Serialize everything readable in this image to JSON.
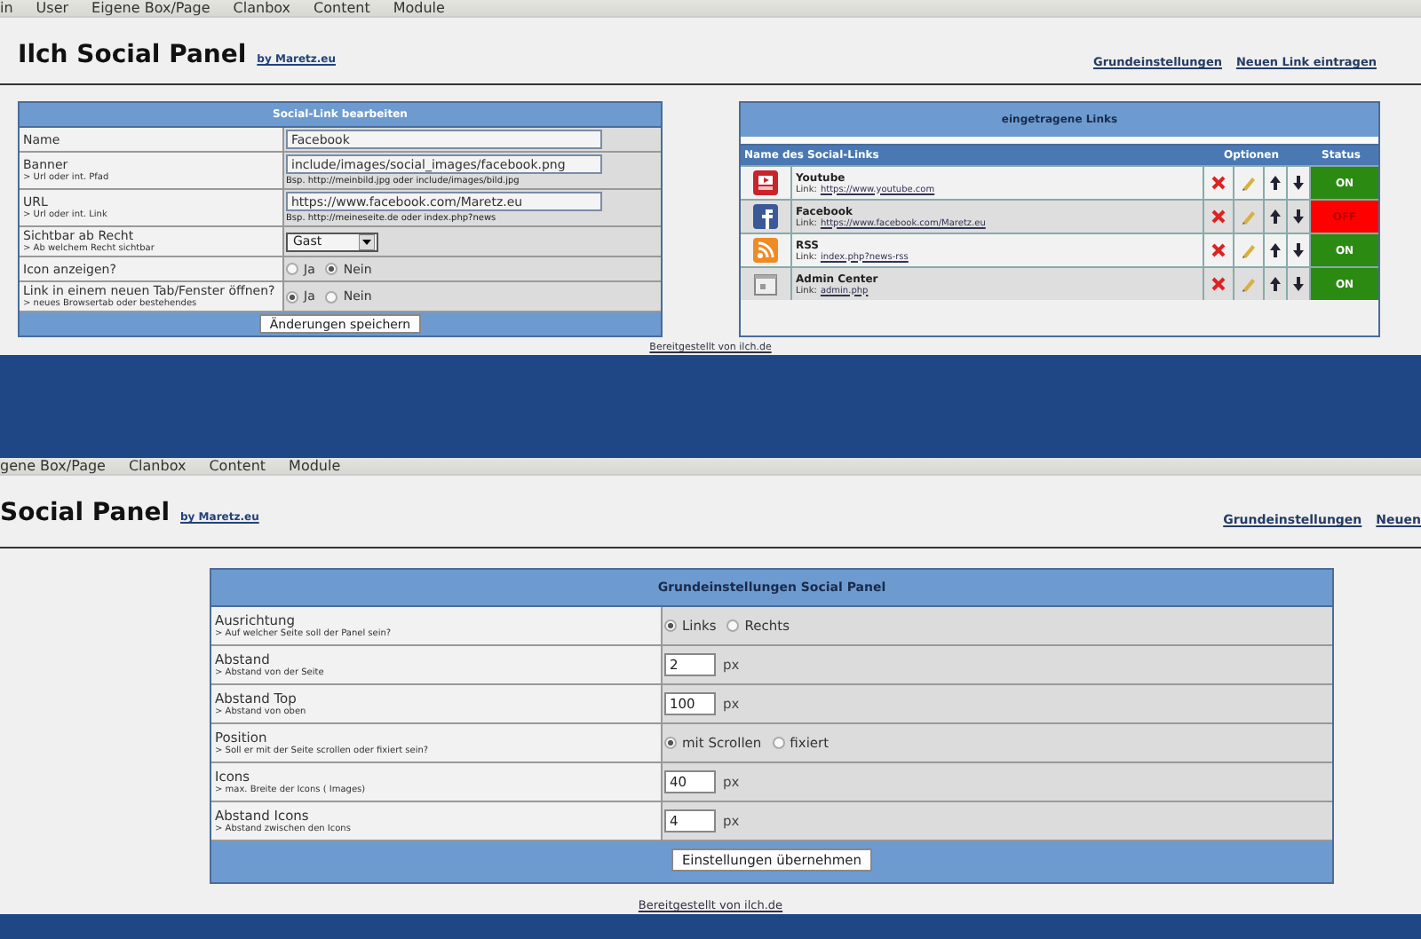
{
  "top_screen": {
    "menu": [
      "in",
      "User",
      "Eigene Box/Page",
      "Clanbox",
      "Content",
      "Module"
    ],
    "title": "Ilch Social Panel",
    "byline": "by Maretz.eu",
    "header_links": [
      "Grundeinstellungen",
      "Neuen Link eintragen"
    ],
    "edit_form": {
      "title": "Social-Link bearbeiten",
      "rows": [
        {
          "kind": "text",
          "label": "Name",
          "value": "Facebook"
        },
        {
          "kind": "text",
          "label": "Banner",
          "hint": "> Url oder int. Pfad",
          "value": "include/images/social_images/facebook.png",
          "example": "Bsp. http://meinbild.jpg oder include/images/bild.jpg"
        },
        {
          "kind": "text",
          "label": "URL",
          "hint": "> Url oder int. Link",
          "value": "https://www.facebook.com/Maretz.eu",
          "example": "Bsp. http://meineseite.de oder index.php?news"
        },
        {
          "kind": "select",
          "label": "Sichtbar ab Recht",
          "hint": "> Ab welchem Recht sichtbar",
          "value": "Gast"
        },
        {
          "kind": "radio",
          "label": "Icon anzeigen?",
          "options": [
            {
              "label": "Ja",
              "selected": false
            },
            {
              "label": "Nein",
              "selected": true
            }
          ]
        },
        {
          "kind": "radio",
          "label": "Link in einem neuen Tab/Fenster öffnen?",
          "hint": "> neues Browsertab oder bestehendes",
          "options": [
            {
              "label": "Ja",
              "selected": true
            },
            {
              "label": "Nein",
              "selected": false
            }
          ]
        }
      ],
      "submit": "Änderungen speichern"
    },
    "links_table": {
      "title": "eingetragene Links",
      "columns": [
        "Name des Social-Links",
        "Optionen",
        "Status"
      ],
      "rows": [
        {
          "kind": "video",
          "name": "Youtube",
          "link_label": "Link:",
          "url": "https://www.youtube.com",
          "status": "ON",
          "on": true
        },
        {
          "kind": "f-logo",
          "name": "Facebook",
          "link_label": "Link:",
          "url": "https://www.facebook.com/Maretz.eu",
          "status": "OFF",
          "on": false
        },
        {
          "kind": "rss",
          "name": "RSS",
          "link_label": "Link:",
          "url": "index.php?news-rss",
          "status": "ON",
          "on": true
        },
        {
          "kind": "window",
          "name": "Admin Center",
          "link_label": "Link:",
          "url": "admin.php",
          "status": "ON",
          "on": true
        }
      ]
    },
    "footer": "Bereitgestellt von ilch.de"
  },
  "bottom_screen": {
    "menu": [
      "gene Box/Page",
      "Clanbox",
      "Content",
      "Module"
    ],
    "title": "Social Panel",
    "byline": "by Maretz.eu",
    "header_links": [
      "Grundeinstellungen",
      "Neuen"
    ],
    "settings_form": {
      "title": "Grundeinstellungen Social Panel",
      "rows": [
        {
          "kind": "radio",
          "label": "Ausrichtung",
          "hint": "> Auf welcher Seite soll der Panel sein?",
          "options": [
            {
              "label": "Links",
              "selected": true
            },
            {
              "label": "Rechts",
              "selected": false
            }
          ]
        },
        {
          "kind": "number",
          "label": "Abstand",
          "hint": "> Abstand von der Seite",
          "value": "2",
          "unit": "px"
        },
        {
          "kind": "number",
          "label": "Abstand Top",
          "hint": "> Abstand von oben",
          "value": "100",
          "unit": "px"
        },
        {
          "kind": "radio",
          "label": "Position",
          "hint": "> Soll er mit der Seite scrollen oder fixiert sein?",
          "options": [
            {
              "label": "mit Scrollen",
              "selected": true
            },
            {
              "label": "fixiert",
              "selected": false
            }
          ]
        },
        {
          "kind": "number",
          "label": "Icons",
          "hint": "> max. Breite der Icons ( Images)",
          "value": "40",
          "unit": "px"
        },
        {
          "kind": "number",
          "label": "Abstand Icons",
          "hint": "> Abstand zwischen den Icons",
          "value": "4",
          "unit": "px"
        }
      ],
      "submit": "Einstellungen übernehmen"
    },
    "footer": "Bereitgestellt von ilch.de"
  }
}
